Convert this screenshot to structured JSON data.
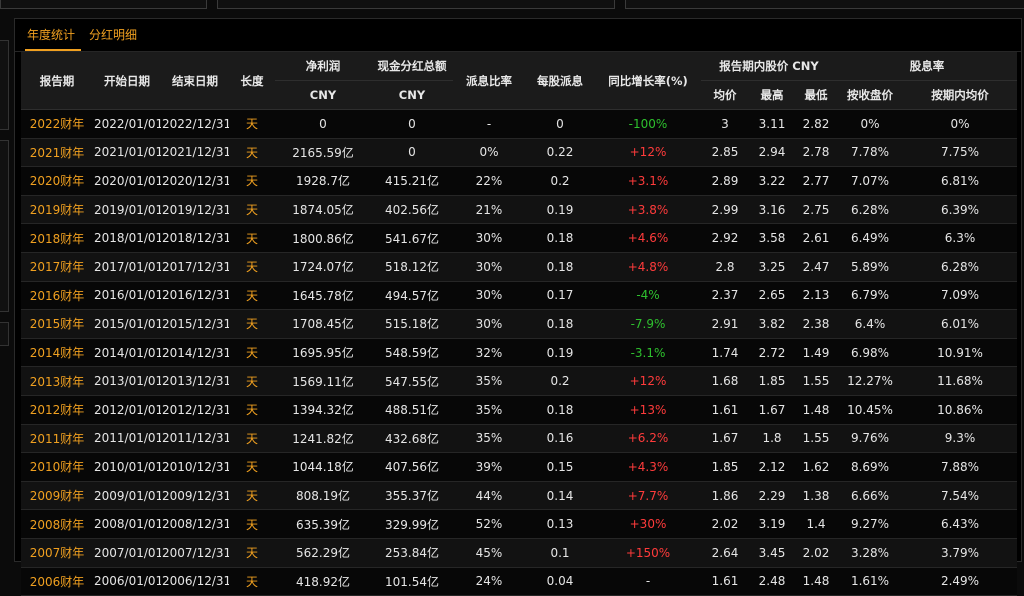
{
  "tabs": [
    {
      "label": "年度统计",
      "active": true
    },
    {
      "label": "分红明细",
      "active": false
    }
  ],
  "headers": {
    "period": "报告期",
    "start": "开始日期",
    "end": "结束日期",
    "length": "长度",
    "net_profit": "净利润",
    "net_profit_unit": "CNY",
    "dividend_total": "现金分红总额",
    "dividend_total_unit": "CNY",
    "payout_ratio": "派息比率",
    "dps": "每股派息",
    "yoy": "同比增长率(%)",
    "price_group": "报告期内股价 CNY",
    "price_avg": "均价",
    "price_high": "最高",
    "price_low": "最低",
    "yield_group": "股息率",
    "yield_close": "按收盘价",
    "yield_avg": "按期内均价"
  },
  "rows": [
    {
      "period": "2022财年",
      "start": "2022/01/01",
      "end": "2022/12/31",
      "length": "天",
      "net_profit": "0",
      "dividend": "0",
      "payout": "-",
      "dps": "0",
      "yoy": "-100%",
      "yoy_color": "green",
      "avg": "3",
      "high": "3.11",
      "low": "2.82",
      "yield_close": "0%",
      "yield_avg": "0%"
    },
    {
      "period": "2021财年",
      "start": "2021/01/01",
      "end": "2021/12/31",
      "length": "天",
      "net_profit": "2165.59亿",
      "dividend": "0",
      "payout": "0%",
      "dps": "0.22",
      "yoy": "+12%",
      "yoy_color": "red",
      "avg": "2.85",
      "high": "2.94",
      "low": "2.78",
      "yield_close": "7.78%",
      "yield_avg": "7.75%"
    },
    {
      "period": "2020财年",
      "start": "2020/01/01",
      "end": "2020/12/31",
      "length": "天",
      "net_profit": "1928.7亿",
      "dividend": "415.21亿",
      "payout": "22%",
      "dps": "0.2",
      "yoy": "+3.1%",
      "yoy_color": "red",
      "avg": "2.89",
      "high": "3.22",
      "low": "2.77",
      "yield_close": "7.07%",
      "yield_avg": "6.81%"
    },
    {
      "period": "2019财年",
      "start": "2019/01/01",
      "end": "2019/12/31",
      "length": "天",
      "net_profit": "1874.05亿",
      "dividend": "402.56亿",
      "payout": "21%",
      "dps": "0.19",
      "yoy": "+3.8%",
      "yoy_color": "red",
      "avg": "2.99",
      "high": "3.16",
      "low": "2.75",
      "yield_close": "6.28%",
      "yield_avg": "6.39%"
    },
    {
      "period": "2018财年",
      "start": "2018/01/01",
      "end": "2018/12/31",
      "length": "天",
      "net_profit": "1800.86亿",
      "dividend": "541.67亿",
      "payout": "30%",
      "dps": "0.18",
      "yoy": "+4.6%",
      "yoy_color": "red",
      "avg": "2.92",
      "high": "3.58",
      "low": "2.61",
      "yield_close": "6.49%",
      "yield_avg": "6.3%"
    },
    {
      "period": "2017财年",
      "start": "2017/01/01",
      "end": "2017/12/31",
      "length": "天",
      "net_profit": "1724.07亿",
      "dividend": "518.12亿",
      "payout": "30%",
      "dps": "0.18",
      "yoy": "+4.8%",
      "yoy_color": "red",
      "avg": "2.8",
      "high": "3.25",
      "low": "2.47",
      "yield_close": "5.89%",
      "yield_avg": "6.28%"
    },
    {
      "period": "2016财年",
      "start": "2016/01/01",
      "end": "2016/12/31",
      "length": "天",
      "net_profit": "1645.78亿",
      "dividend": "494.57亿",
      "payout": "30%",
      "dps": "0.17",
      "yoy": "-4%",
      "yoy_color": "green",
      "avg": "2.37",
      "high": "2.65",
      "low": "2.13",
      "yield_close": "6.79%",
      "yield_avg": "7.09%"
    },
    {
      "period": "2015财年",
      "start": "2015/01/01",
      "end": "2015/12/31",
      "length": "天",
      "net_profit": "1708.45亿",
      "dividend": "515.18亿",
      "payout": "30%",
      "dps": "0.18",
      "yoy": "-7.9%",
      "yoy_color": "green",
      "avg": "2.91",
      "high": "3.82",
      "low": "2.38",
      "yield_close": "6.4%",
      "yield_avg": "6.01%"
    },
    {
      "period": "2014财年",
      "start": "2014/01/01",
      "end": "2014/12/31",
      "length": "天",
      "net_profit": "1695.95亿",
      "dividend": "548.59亿",
      "payout": "32%",
      "dps": "0.19",
      "yoy": "-3.1%",
      "yoy_color": "green",
      "avg": "1.74",
      "high": "2.72",
      "low": "1.49",
      "yield_close": "6.98%",
      "yield_avg": "10.91%"
    },
    {
      "period": "2013财年",
      "start": "2013/01/01",
      "end": "2013/12/31",
      "length": "天",
      "net_profit": "1569.11亿",
      "dividend": "547.55亿",
      "payout": "35%",
      "dps": "0.2",
      "yoy": "+12%",
      "yoy_color": "red",
      "avg": "1.68",
      "high": "1.85",
      "low": "1.55",
      "yield_close": "12.27%",
      "yield_avg": "11.68%"
    },
    {
      "period": "2012财年",
      "start": "2012/01/01",
      "end": "2012/12/31",
      "length": "天",
      "net_profit": "1394.32亿",
      "dividend": "488.51亿",
      "payout": "35%",
      "dps": "0.18",
      "yoy": "+13%",
      "yoy_color": "red",
      "avg": "1.61",
      "high": "1.67",
      "low": "1.48",
      "yield_close": "10.45%",
      "yield_avg": "10.86%"
    },
    {
      "period": "2011财年",
      "start": "2011/01/01",
      "end": "2011/12/31",
      "length": "天",
      "net_profit": "1241.82亿",
      "dividend": "432.68亿",
      "payout": "35%",
      "dps": "0.16",
      "yoy": "+6.2%",
      "yoy_color": "red",
      "avg": "1.67",
      "high": "1.8",
      "low": "1.55",
      "yield_close": "9.76%",
      "yield_avg": "9.3%"
    },
    {
      "period": "2010财年",
      "start": "2010/01/01",
      "end": "2010/12/31",
      "length": "天",
      "net_profit": "1044.18亿",
      "dividend": "407.56亿",
      "payout": "39%",
      "dps": "0.15",
      "yoy": "+4.3%",
      "yoy_color": "red",
      "avg": "1.85",
      "high": "2.12",
      "low": "1.62",
      "yield_close": "8.69%",
      "yield_avg": "7.88%"
    },
    {
      "period": "2009财年",
      "start": "2009/01/01",
      "end": "2009/12/31",
      "length": "天",
      "net_profit": "808.19亿",
      "dividend": "355.37亿",
      "payout": "44%",
      "dps": "0.14",
      "yoy": "+7.7%",
      "yoy_color": "red",
      "avg": "1.86",
      "high": "2.29",
      "low": "1.38",
      "yield_close": "6.66%",
      "yield_avg": "7.54%"
    },
    {
      "period": "2008财年",
      "start": "2008/01/01",
      "end": "2008/12/31",
      "length": "天",
      "net_profit": "635.39亿",
      "dividend": "329.99亿",
      "payout": "52%",
      "dps": "0.13",
      "yoy": "+30%",
      "yoy_color": "red",
      "avg": "2.02",
      "high": "3.19",
      "low": "1.4",
      "yield_close": "9.27%",
      "yield_avg": "6.43%"
    },
    {
      "period": "2007财年",
      "start": "2007/01/01",
      "end": "2007/12/31",
      "length": "天",
      "net_profit": "562.29亿",
      "dividend": "253.84亿",
      "payout": "45%",
      "dps": "0.1",
      "yoy": "+150%",
      "yoy_color": "red",
      "avg": "2.64",
      "high": "3.45",
      "low": "2.02",
      "yield_close": "3.28%",
      "yield_avg": "3.79%"
    },
    {
      "period": "2006财年",
      "start": "2006/01/01",
      "end": "2006/12/31",
      "length": "天",
      "net_profit": "418.92亿",
      "dividend": "101.54亿",
      "payout": "24%",
      "dps": "0.04",
      "yoy": "-",
      "yoy_color": "neutral",
      "avg": "1.61",
      "high": "2.48",
      "low": "1.48",
      "yield_close": "1.61%",
      "yield_avg": "2.49%"
    }
  ],
  "colors": {
    "accent": "#f0a020",
    "up": "#ff3b3b",
    "down": "#2ec02e"
  }
}
